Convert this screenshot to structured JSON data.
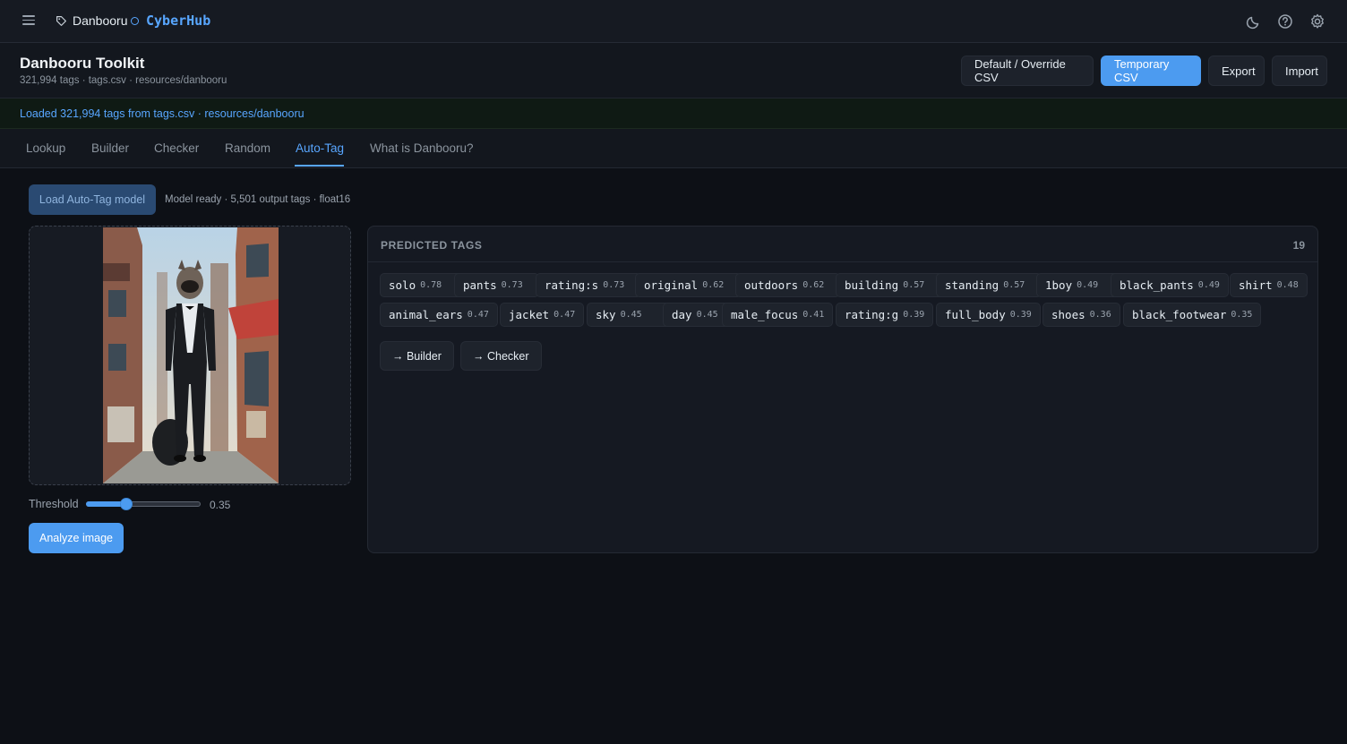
{
  "topbar": {
    "breadcrumb": "Danbooru",
    "brand": "CyberHub",
    "icons": [
      "menu-icon",
      "tag-icon",
      "moon-icon",
      "help-icon",
      "gear-icon"
    ]
  },
  "header": {
    "title": "Danbooru Toolkit",
    "subtitle": "321,994 tags · tags.csv · resources/danbooru",
    "buttons": [
      "Default / Override CSV",
      "Temporary CSV",
      "Export",
      "Import"
    ]
  },
  "banner": {
    "text": "Loaded 321,994 tags from tags.csv · resources/danbooru"
  },
  "tabs": [
    "Lookup",
    "Builder",
    "Checker",
    "Random",
    "Auto-Tag",
    "What is Danbooru?"
  ],
  "active_tab": "Auto-Tag",
  "autotag": {
    "load_label": "Load Auto-Tag model",
    "model_status": "Model ready · 5,501 output tags · float16",
    "threshold_label": "Threshold",
    "threshold_value": "0.35",
    "threshold_fraction": 0.35,
    "analyze_label": "Analyze image"
  },
  "predicted": {
    "title": "PREDICTED TAGS",
    "count": "19",
    "tags": [
      {
        "name": "solo",
        "score": "0.78"
      },
      {
        "name": "pants",
        "score": "0.73"
      },
      {
        "name": "rating:s",
        "score": "0.73"
      },
      {
        "name": "original",
        "score": "0.62"
      },
      {
        "name": "outdoors",
        "score": "0.62"
      },
      {
        "name": "building",
        "score": "0.57"
      },
      {
        "name": "standing",
        "score": "0.57"
      },
      {
        "name": "1boy",
        "score": "0.49"
      },
      {
        "name": "black_pants",
        "score": "0.49"
      },
      {
        "name": "shirt",
        "score": "0.48"
      },
      {
        "name": "animal_ears",
        "score": "0.47"
      },
      {
        "name": "jacket",
        "score": "0.47"
      },
      {
        "name": "sky",
        "score": "0.45"
      },
      {
        "name": "day",
        "score": "0.45"
      },
      {
        "name": "male_focus",
        "score": "0.41"
      },
      {
        "name": "rating:g",
        "score": "0.39"
      },
      {
        "name": "full_body",
        "score": "0.39"
      },
      {
        "name": "shoes",
        "score": "0.36"
      },
      {
        "name": "black_footwear",
        "score": "0.35"
      }
    ],
    "send_builder": "→ Builder",
    "send_checker": "→ Checker"
  },
  "colors": {
    "accent": "#4c9bf0",
    "background": "#0d1016",
    "panel": "#151922"
  }
}
